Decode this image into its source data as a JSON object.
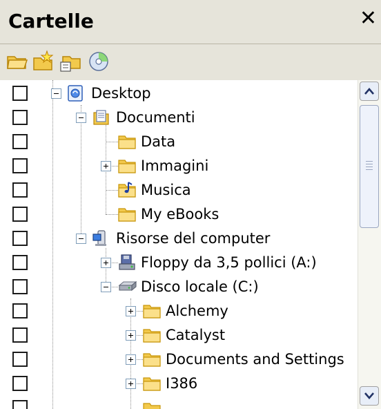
{
  "panel": {
    "title": "Cartelle",
    "close_glyph": "✕"
  },
  "toolbar": {
    "icons": [
      "folder-up-icon",
      "new-folder-icon",
      "move-folder-icon",
      "disc-icon"
    ]
  },
  "tree": {
    "nodes": [
      {
        "label": "Desktop",
        "icon": "desktop-icon",
        "expander": "minus"
      },
      {
        "label": "Documenti",
        "icon": "documents-icon",
        "expander": "minus"
      },
      {
        "label": "Data",
        "icon": "folder-icon",
        "expander": "none"
      },
      {
        "label": "Immagini",
        "icon": "folder-icon",
        "expander": "plus"
      },
      {
        "label": "Musica",
        "icon": "music-folder-icon",
        "expander": "none"
      },
      {
        "label": "My eBooks",
        "icon": "folder-icon",
        "expander": "none"
      },
      {
        "label": "Risorse del computer",
        "icon": "computer-icon",
        "expander": "minus"
      },
      {
        "label": "Floppy da 3,5 pollici (A:)",
        "icon": "floppy-icon",
        "expander": "plus"
      },
      {
        "label": "Disco locale (C:)",
        "icon": "hard-disk-icon",
        "expander": "minus"
      },
      {
        "label": "Alchemy",
        "icon": "folder-icon",
        "expander": "plus"
      },
      {
        "label": "Catalyst",
        "icon": "folder-icon",
        "expander": "plus"
      },
      {
        "label": "Documents and Settings",
        "icon": "folder-icon",
        "expander": "plus"
      },
      {
        "label": "I386",
        "icon": "folder-icon",
        "expander": "plus"
      }
    ]
  },
  "colors": {
    "header_bg": "#e6e4da",
    "folder_yellow": "#f7d56c",
    "scrollbar_blue": "#eef2fb"
  }
}
